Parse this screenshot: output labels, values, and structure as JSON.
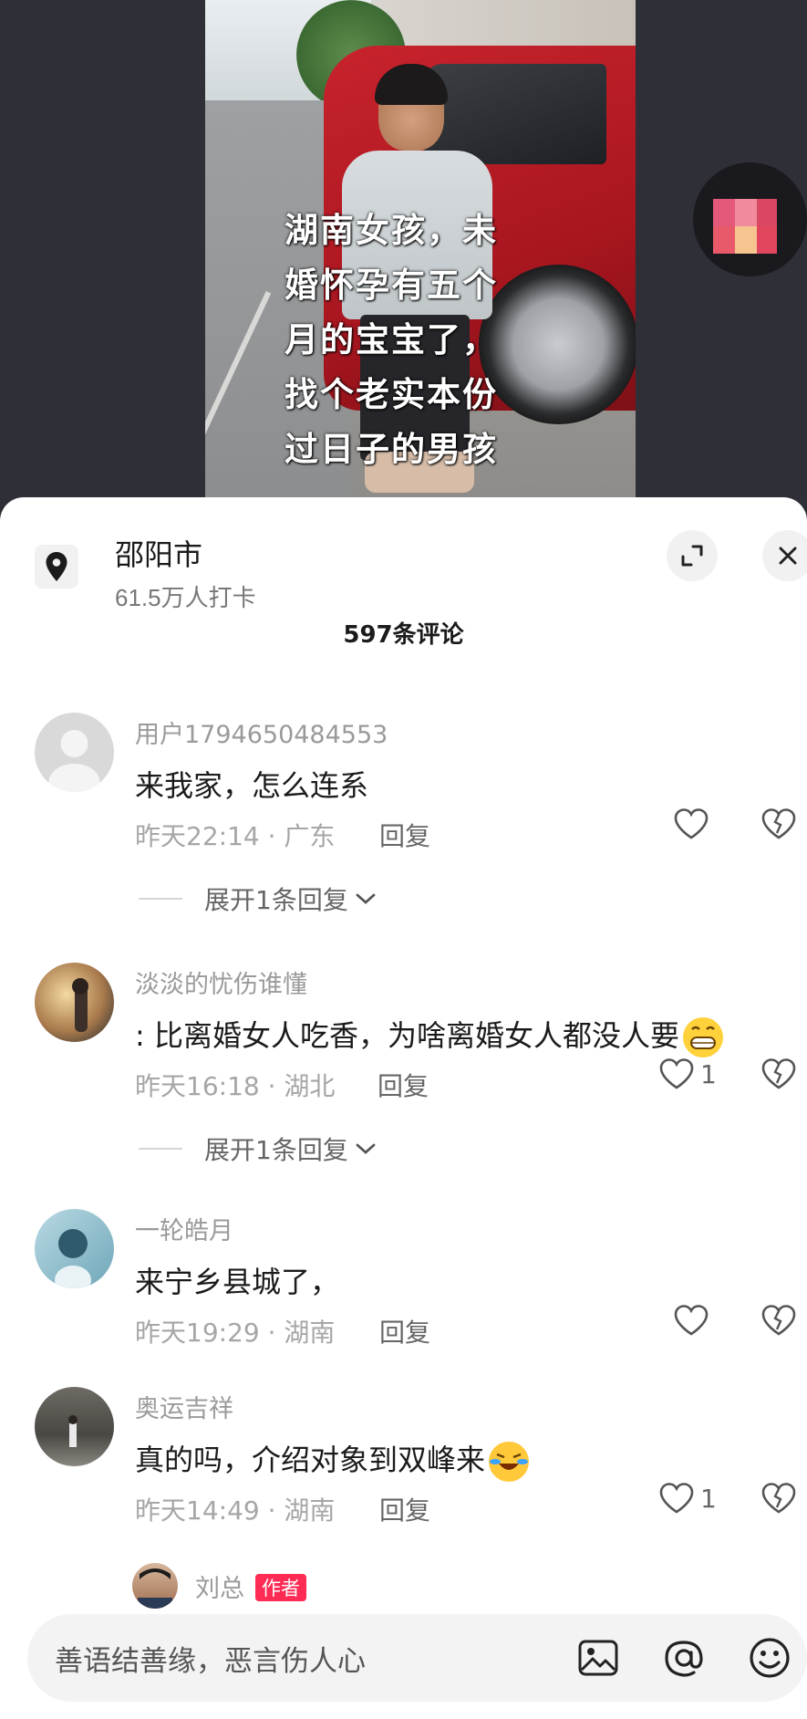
{
  "video": {
    "caption": "湖南女孩，未\n婚怀孕有五个\n月的宝宝了，\n找个老实本份\n过日子的男孩"
  },
  "location": {
    "name": "邵阳市",
    "checkins": "61.5万人打卡"
  },
  "comments_header": "597条评论",
  "comments": [
    {
      "user": "用户1794650484553",
      "text": "来我家，怎么连系",
      "time": "昨天22:14",
      "region": "广东",
      "reply": "回复",
      "likes": "",
      "expand": "展开1条回复"
    },
    {
      "user": "淡淡的忧伤谁懂",
      "text": ": 比离婚女人吃香，为啥离婚女人都没人要",
      "time": "昨天16:18",
      "region": "湖北",
      "reply": "回复",
      "likes": "1",
      "expand": "展开1条回复"
    },
    {
      "user": "一轮皓月",
      "text": "来宁乡县城了，",
      "time": "昨天19:29",
      "region": "湖南",
      "reply": "回复",
      "likes": ""
    },
    {
      "user": "奥运吉祥",
      "text": "真的吗，介绍对象到双峰来",
      "time": "昨天14:49",
      "region": "湖南",
      "reply": "回复",
      "likes": "1"
    },
    {
      "user": "刘总",
      "tag": "作者"
    }
  ],
  "input": {
    "placeholder": "善语结善缘，恶言伤人心"
  },
  "icons": {
    "location": "location-pin-icon",
    "expand": "expand-icon",
    "close": "close-icon",
    "like": "heart-outline-icon",
    "dislike": "broken-heart-icon",
    "image": "image-icon",
    "mention": "at-icon",
    "emoji": "emoji-icon"
  },
  "colors": {
    "author_tag": "#fe2c55",
    "background_top": "#2e2f37"
  }
}
